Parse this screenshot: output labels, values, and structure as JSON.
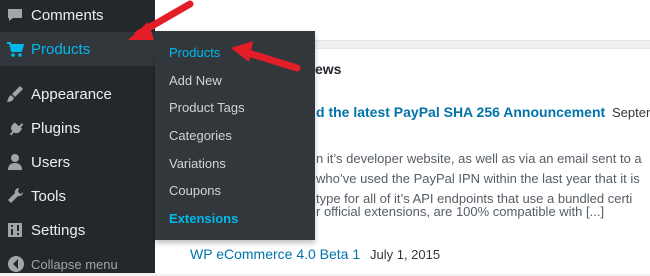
{
  "sidebar": {
    "items": [
      {
        "label": "Comments",
        "icon": "comments-icon"
      },
      {
        "label": "Products",
        "icon": "cart-icon"
      },
      {
        "label": "Appearance",
        "icon": "paintbrush-icon"
      },
      {
        "label": "Plugins",
        "icon": "plug-icon"
      },
      {
        "label": "Users",
        "icon": "user-icon"
      },
      {
        "label": "Tools",
        "icon": "wrench-icon"
      },
      {
        "label": "Settings",
        "icon": "settings-icon"
      }
    ],
    "collapse_label": "Collapse menu"
  },
  "submenu": {
    "items": [
      "Products",
      "Add New",
      "Product Tags",
      "Categories",
      "Variations",
      "Coupons",
      "Extensions"
    ]
  },
  "news": {
    "section_title_fragment": "ews",
    "headline1_fragment": "d the latest PayPal SHA 256 Announcement",
    "headline1_date_fragment": "Septer",
    "excerpt_lines": [
      "n it’s developer website, as well as via an email sent to a",
      "who’ve used the PayPal IPN within the last year that it is",
      "type for all of it’s API endpoints that use a bundled certi",
      "r official extensions, are 100% compatible with [...]"
    ],
    "headline2": "WP eCommerce 4.0 Beta 1",
    "headline2_date": "July 1, 2015"
  },
  "colors": {
    "sidebar_bg": "#23282d",
    "submenu_bg": "#32373c",
    "accent": "#00b9eb",
    "link": "#0073aa",
    "arrow": "#e41e26"
  }
}
